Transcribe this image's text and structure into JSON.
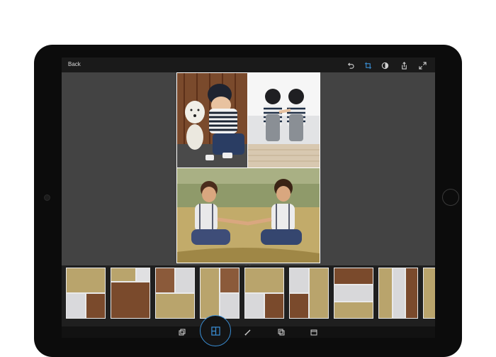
{
  "topbar": {
    "back_label": "Back",
    "icons": [
      "undo-icon",
      "crop-icon",
      "adjust-icon",
      "share-icon",
      "expand-icon"
    ]
  },
  "collage": {
    "photos": [
      "boy-with-white-dog",
      "two-boys-on-dock",
      "boy-and-girl-in-field"
    ]
  },
  "layout_strip": {
    "thumbnails": [
      "layout-1",
      "layout-2",
      "layout-3",
      "layout-4",
      "layout-5",
      "layout-6",
      "layout-7",
      "layout-8",
      "layout-9"
    ]
  },
  "bottombar": {
    "tools": [
      "duplicate-icon",
      "layout-icon",
      "brush-icon",
      "frame-icon",
      "card-icon"
    ],
    "active_tool": "layout-icon"
  },
  "colors": {
    "accent": "#3a8fd6",
    "screen_bg": "#434343",
    "bar_bg": "#1a1a1a"
  }
}
